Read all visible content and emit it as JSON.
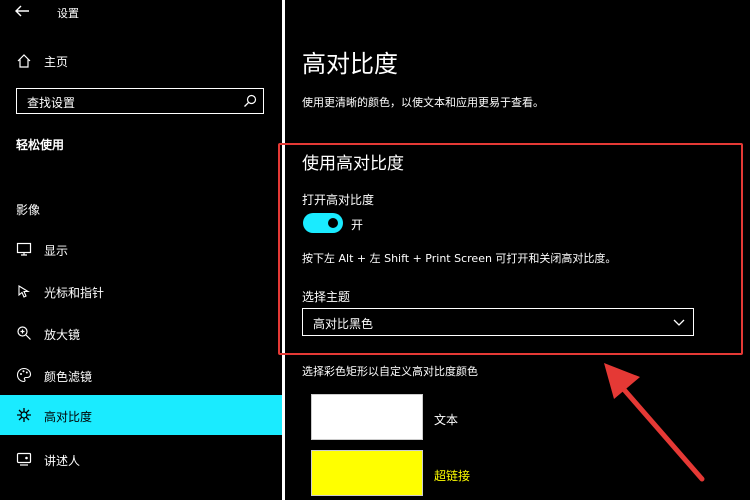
{
  "window": {
    "title": "设置"
  },
  "sidebar": {
    "home_label": "主页",
    "search_placeholder": "查找设置",
    "section_title": "轻松使用",
    "group_label": "影像",
    "items": [
      {
        "label": "显示",
        "icon": "monitor-icon"
      },
      {
        "label": "光标和指针",
        "icon": "cursor-icon"
      },
      {
        "label": "放大镜",
        "icon": "magnifier-icon"
      },
      {
        "label": "颜色滤镜",
        "icon": "palette-icon"
      },
      {
        "label": "高对比度",
        "icon": "contrast-icon",
        "selected": true
      },
      {
        "label": "讲述人",
        "icon": "narrator-icon"
      }
    ]
  },
  "main": {
    "title": "高对比度",
    "description": "使用更清晰的颜色，以使文本和应用更易于查看。",
    "section_title": "使用高对比度",
    "toggle_label": "打开高对比度",
    "toggle_state": "开",
    "shortcut_text": "按下左 Alt + 左 Shift + Print Screen 可打开和关闭高对比度。",
    "theme_label": "选择主题",
    "theme_value": "高对比黑色",
    "color_hint": "选择彩色矩形以自定义高对比度颜色",
    "swatches": [
      {
        "label": "文本",
        "color": "#FFFFFF",
        "label_color": "#FFFFFF"
      },
      {
        "label": "超链接",
        "color": "#FFFF00",
        "label_color": "#FFFF00"
      }
    ]
  },
  "colors": {
    "accent": "#1AEBFF",
    "highlight_border": "#E53935",
    "background": "#000000"
  }
}
